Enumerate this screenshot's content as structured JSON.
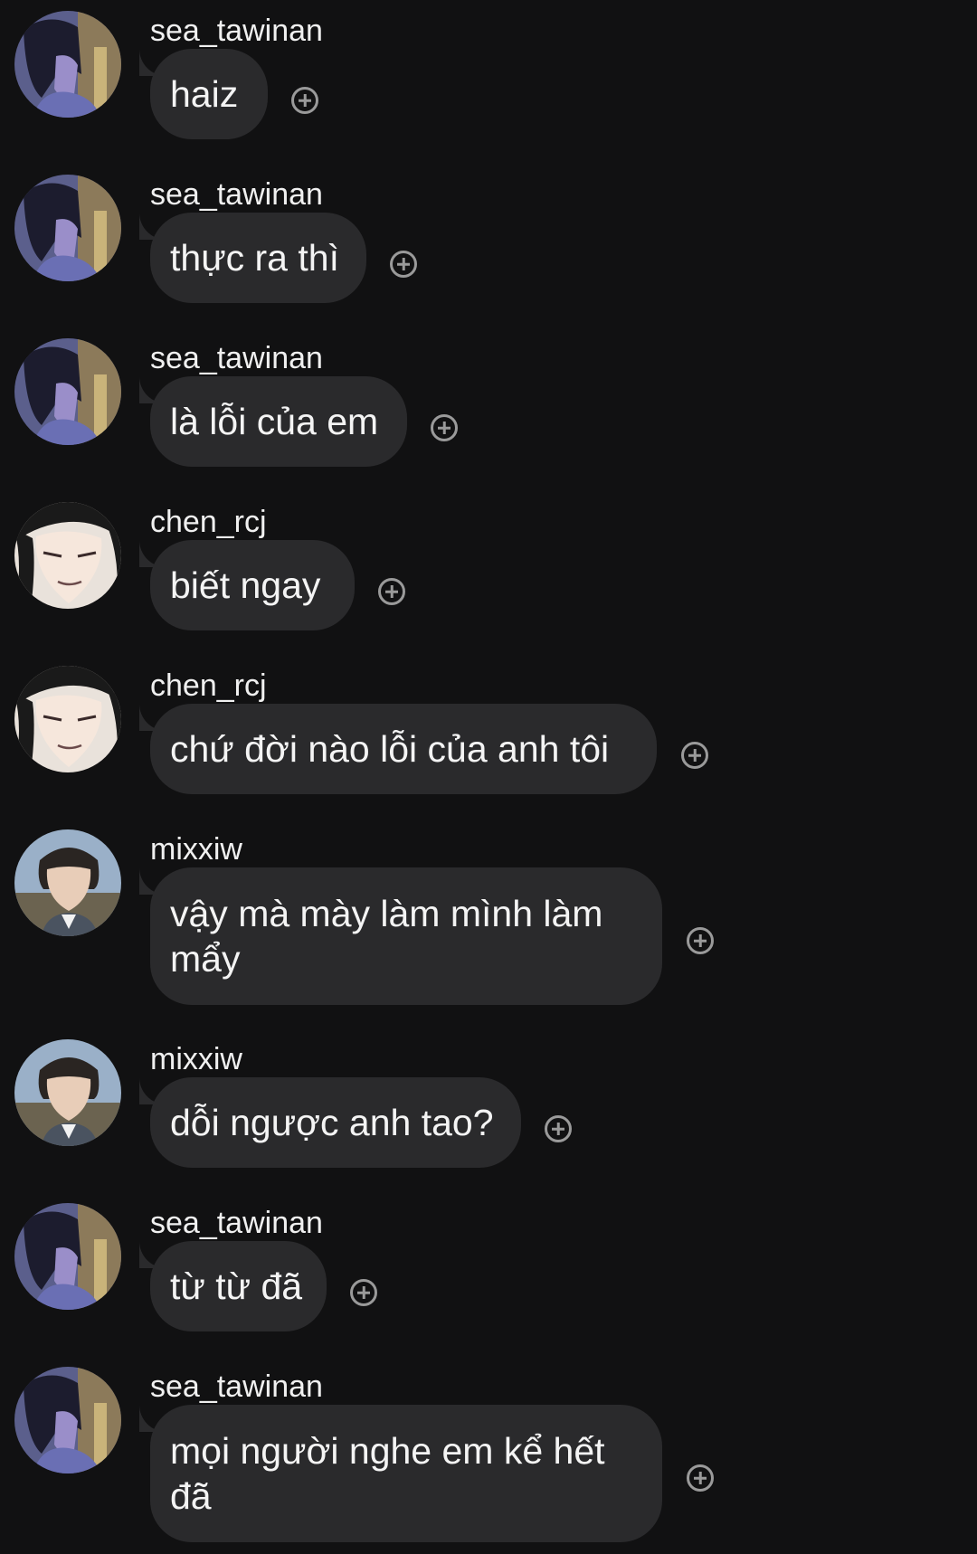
{
  "messages": [
    {
      "sender": "sea_tawinan",
      "avatar": "sea",
      "text": "haiz"
    },
    {
      "sender": "sea_tawinan",
      "avatar": "sea",
      "text": "thực ra thì"
    },
    {
      "sender": "sea_tawinan",
      "avatar": "sea",
      "text": "là lỗi của em"
    },
    {
      "sender": "chen_rcj",
      "avatar": "chen",
      "text": "biết ngay"
    },
    {
      "sender": "chen_rcj",
      "avatar": "chen",
      "text": "chứ đời nào lỗi của anh tôi"
    },
    {
      "sender": "mixxiw",
      "avatar": "mixx",
      "text": "vậy mà mày làm mình làm mẩy"
    },
    {
      "sender": "mixxiw",
      "avatar": "mixx",
      "text": "dỗi ngược anh tao?"
    },
    {
      "sender": "sea_tawinan",
      "avatar": "sea",
      "text": "từ từ đã"
    },
    {
      "sender": "sea_tawinan",
      "avatar": "sea",
      "text": "mọi người nghe em kể hết đã"
    }
  ],
  "icons": {
    "react": "add-reaction-icon"
  },
  "colors": {
    "background": "#111112",
    "bubble": "#2a2a2c",
    "text": "#f4f4f4",
    "icon": "#9a9a9a"
  }
}
